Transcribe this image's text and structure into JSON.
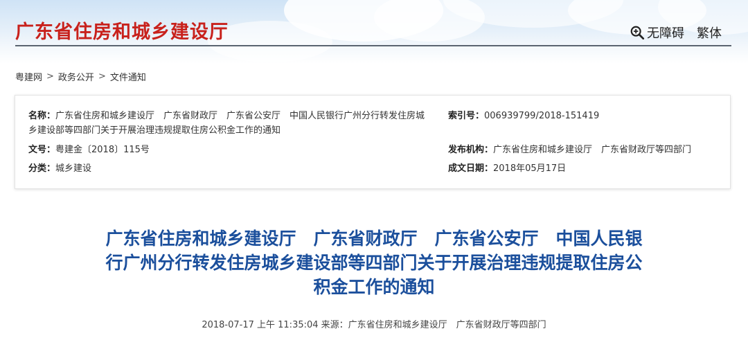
{
  "header": {
    "site_title": "广东省住房和城乡建设厅",
    "accessibility_label": "无障碍",
    "traditional_label": "繁体"
  },
  "breadcrumb": [
    "粤建网",
    "政务公开",
    "文件通知"
  ],
  "breadcrumb_separator": ">",
  "meta": {
    "name": {
      "label": "名称：",
      "value": "广东省住房和城乡建设厅　广东省财政厅　广东省公安厅　中国人民银行广州分行转发住房城乡建设部等四部门关于开展治理违规提取住房公积金工作的通知"
    },
    "index": {
      "label": "索引号：",
      "value": "006939799/2018-151419"
    },
    "doc_no": {
      "label": "文号：",
      "value": "粤建金〔2018〕115号"
    },
    "publisher": {
      "label": "发布机构：",
      "value": "广东省住房和城乡建设厅　广东省财政厅等四部门"
    },
    "category": {
      "label": "分类：",
      "value": "城乡建设"
    },
    "date": {
      "label": "成文日期：",
      "value": "2018年05月17日"
    }
  },
  "article": {
    "title_lines": [
      "广东省住房和城乡建设厅　广东省财政厅　广东省公安厅　中国人民银",
      "行广州分行转发住房城乡建设部等四部门关于开展治理违规提取住房公",
      "积金工作的通知"
    ],
    "publish_info": "2018-07-17 上午 11:35:04  来源：广东省住房和城乡建设厅　广东省财政厅等四部门"
  },
  "colors": {
    "site_title": "#c8211c",
    "article_title": "#1b4f9c"
  },
  "icons": {
    "accessibility": "zoom-in-icon"
  }
}
